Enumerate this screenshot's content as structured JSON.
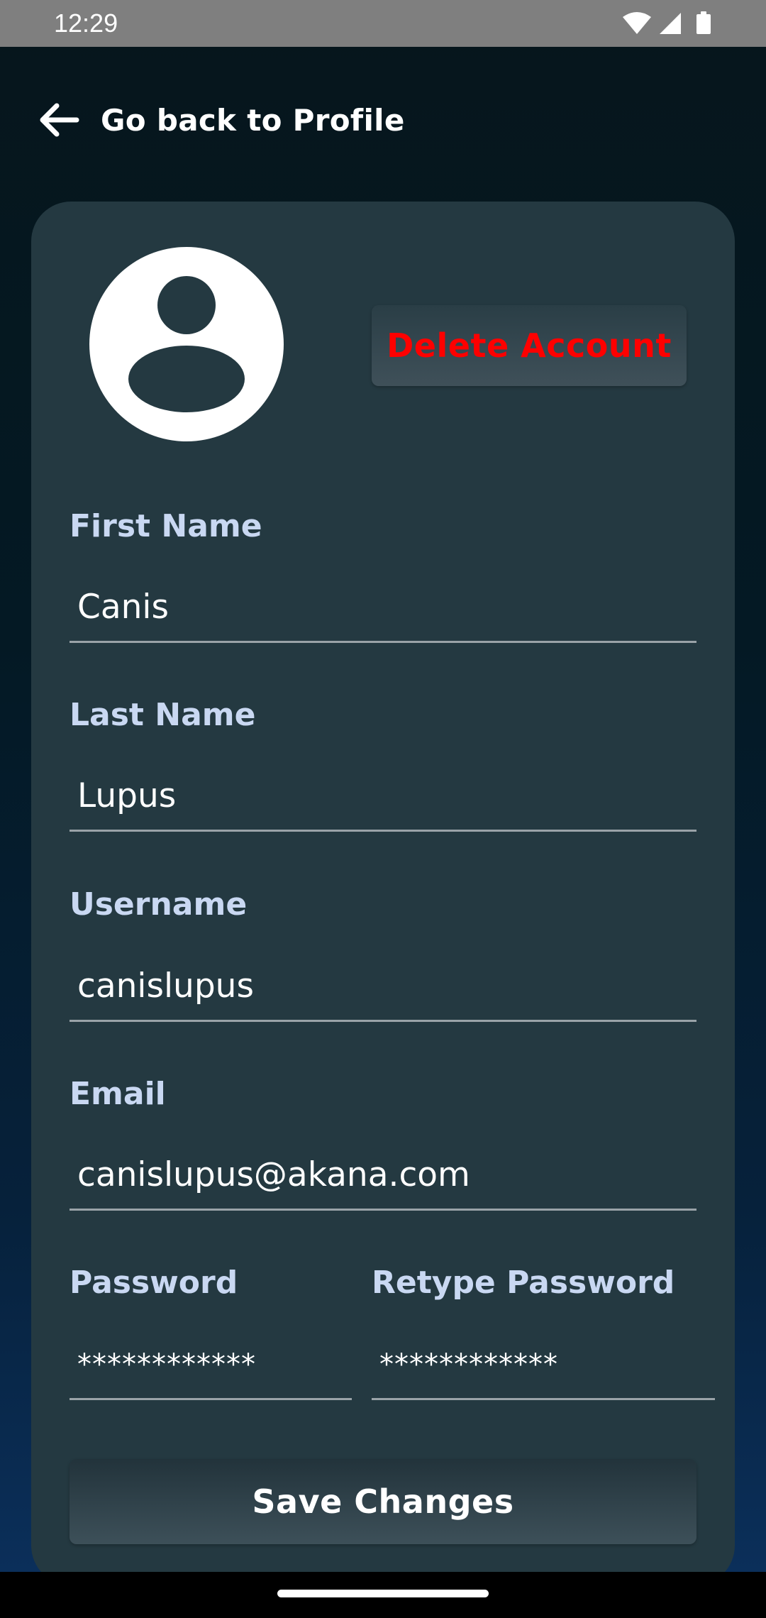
{
  "status_bar": {
    "time": "12:29",
    "icons": [
      "wifi-icon",
      "cell-signal-icon",
      "battery-icon"
    ]
  },
  "header": {
    "back_label": "Go back to Profile",
    "back_icon": "arrow-left-icon"
  },
  "profile": {
    "avatar_icon": "person-avatar-icon",
    "delete_label": "Delete Account",
    "delete_color": "#ff0000"
  },
  "form": {
    "first_name": {
      "label": "First Name",
      "value": "Canis"
    },
    "last_name": {
      "label": "Last Name",
      "value": "Lupus"
    },
    "username": {
      "label": "Username",
      "value": "canislupus"
    },
    "email": {
      "label": "Email",
      "value": "canislupus@akana.com"
    },
    "password": {
      "label": "Password",
      "value": "************"
    },
    "retype_password": {
      "label": "Retype Password",
      "value": "************"
    },
    "save_label": "Save Changes"
  },
  "colors": {
    "label": "#c9d8f2",
    "card": "#243941",
    "delete": "#ff0000"
  }
}
